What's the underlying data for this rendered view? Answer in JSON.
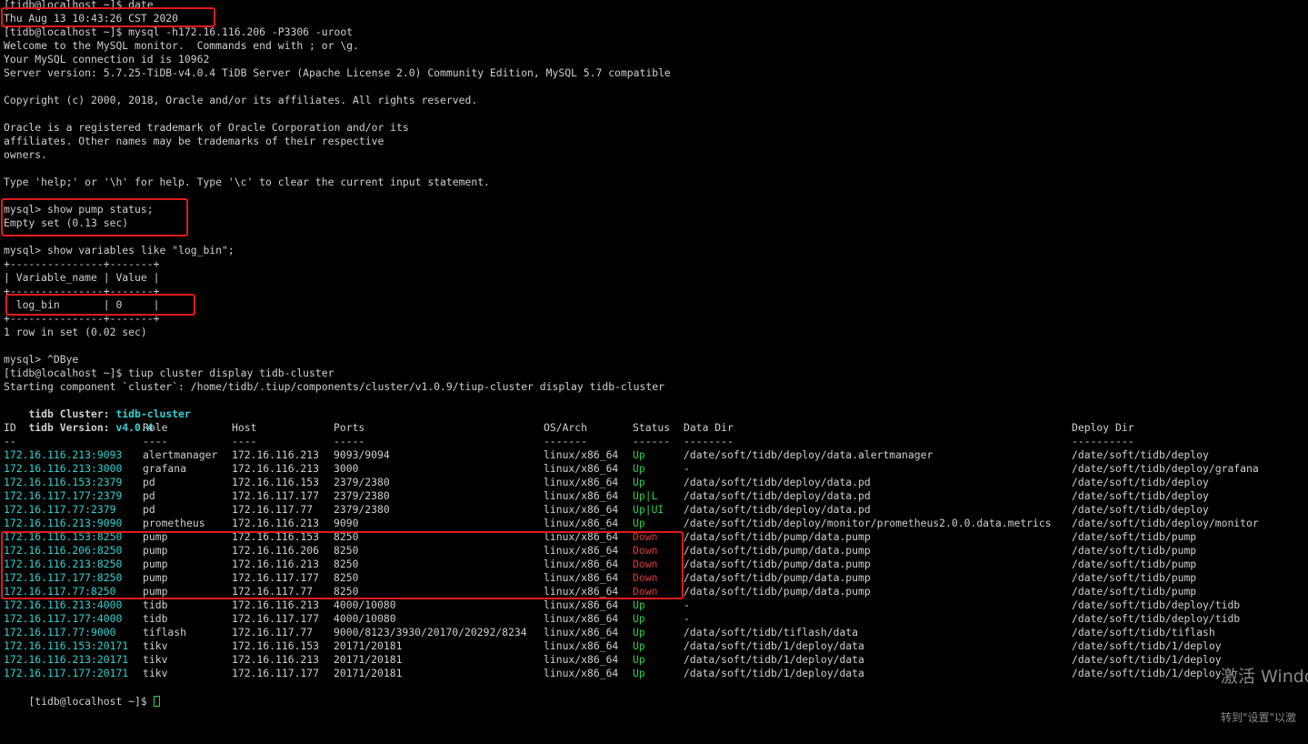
{
  "terminal": {
    "lines": [
      "[tidb@localhost ~]$ date",
      "Thu Aug 13 10:43:26 CST 2020",
      "[tidb@localhost ~]$ mysql -h172.16.116.206 -P3306 -uroot",
      "Welcome to the MySQL monitor.  Commands end with ; or \\g.",
      "Your MySQL connection id is 10962",
      "Server version: 5.7.25-TiDB-v4.0.4 TiDB Server (Apache License 2.0) Community Edition, MySQL 5.7 compatible",
      "",
      "Copyright (c) 2000, 2018, Oracle and/or its affiliates. All rights reserved.",
      "",
      "Oracle is a registered trademark of Oracle Corporation and/or its",
      "affiliates. Other names may be trademarks of their respective",
      "owners.",
      "",
      "Type 'help;' or '\\h' for help. Type '\\c' to clear the current input statement.",
      "",
      "mysql> show pump status;",
      "Empty set (0.13 sec)",
      "",
      "mysql> show variables like \"log_bin\";",
      "+---------------+-------+",
      "| Variable_name | Value |",
      "+---------------+-------+",
      "| log_bin       | 0     |",
      "+---------------+-------+",
      "1 row in set (0.02 sec)",
      "",
      "mysql> ^DBye",
      "[tidb@localhost ~]$ tiup cluster display tidb-cluster",
      "Starting component `cluster`: /home/tidb/.tiup/components/cluster/v1.0.9/tiup-cluster display tidb-cluster"
    ],
    "cluster_label": "tidb Cluster: ",
    "cluster_name": "tidb-cluster",
    "version_label": "tidb Version: ",
    "version_value": "v4.0.4",
    "table": {
      "headers": [
        "ID",
        "Role",
        "Host",
        "Ports",
        "OS/Arch",
        "Status",
        "Data Dir",
        "Deploy Dir"
      ],
      "separators": [
        "--",
        "----",
        "----",
        "-----",
        "-------",
        "------",
        "--------",
        "----------"
      ],
      "rows": [
        [
          "172.16.116.213:9093",
          "alertmanager",
          "172.16.116.213",
          "9093/9094",
          "linux/x86_64",
          "Up",
          "/date/soft/tidb/deploy/data.alertmanager",
          "/date/soft/tidb/deploy"
        ],
        [
          "172.16.116.213:3000",
          "grafana",
          "172.16.116.213",
          "3000",
          "linux/x86_64",
          "Up",
          "-",
          "/date/soft/tidb/deploy/grafana"
        ],
        [
          "172.16.116.153:2379",
          "pd",
          "172.16.116.153",
          "2379/2380",
          "linux/x86_64",
          "Up",
          "/data/soft/tidb/deploy/data.pd",
          "/date/soft/tidb/deploy"
        ],
        [
          "172.16.117.177:2379",
          "pd",
          "172.16.117.177",
          "2379/2380",
          "linux/x86_64",
          "Up|L",
          "/data/soft/tidb/deploy/data.pd",
          "/date/soft/tidb/deploy"
        ],
        [
          "172.16.117.77:2379",
          "pd",
          "172.16.117.77",
          "2379/2380",
          "linux/x86_64",
          "Up|UI",
          "/data/soft/tidb/deploy/data.pd",
          "/date/soft/tidb/deploy"
        ],
        [
          "172.16.116.213:9090",
          "prometheus",
          "172.16.116.213",
          "9090",
          "linux/x86_64",
          "Up",
          "/date/soft/tidb/deploy/monitor/prometheus2.0.0.data.metrics",
          "/date/soft/tidb/deploy/monitor"
        ],
        [
          "172.16.116.153:8250",
          "pump",
          "172.16.116.153",
          "8250",
          "linux/x86_64",
          "Down",
          "/data/soft/tidb/pump/data.pump",
          "/date/soft/tidb/pump"
        ],
        [
          "172.16.116.206:8250",
          "pump",
          "172.16.116.206",
          "8250",
          "linux/x86_64",
          "Down",
          "/data/soft/tidb/pump/data.pump",
          "/date/soft/tidb/pump"
        ],
        [
          "172.16.116.213:8250",
          "pump",
          "172.16.116.213",
          "8250",
          "linux/x86_64",
          "Down",
          "/data/soft/tidb/pump/data.pump",
          "/date/soft/tidb/pump"
        ],
        [
          "172.16.117.177:8250",
          "pump",
          "172.16.117.177",
          "8250",
          "linux/x86_64",
          "Down",
          "/data/soft/tidb/pump/data.pump",
          "/date/soft/tidb/pump"
        ],
        [
          "172.16.117.77:8250",
          "pump",
          "172.16.117.77",
          "8250",
          "linux/x86_64",
          "Down",
          "/data/soft/tidb/pump/data.pump",
          "/date/soft/tidb/pump"
        ],
        [
          "172.16.116.213:4000",
          "tidb",
          "172.16.116.213",
          "4000/10080",
          "linux/x86_64",
          "Up",
          "-",
          "/date/soft/tidb/deploy/tidb"
        ],
        [
          "172.16.117.177:4000",
          "tidb",
          "172.16.117.177",
          "4000/10080",
          "linux/x86_64",
          "Up",
          "-",
          "/date/soft/tidb/deploy/tidb"
        ],
        [
          "172.16.117.77:9000",
          "tiflash",
          "172.16.117.77",
          "9000/8123/3930/20170/20292/8234",
          "linux/x86_64",
          "Up",
          "/data/soft/tidb/tiflash/data",
          "/date/soft/tidb/tiflash"
        ],
        [
          "172.16.116.153:20171",
          "tikv",
          "172.16.116.153",
          "20171/20181",
          "linux/x86_64",
          "Up",
          "/data/soft/tidb/1/deploy/data",
          "/date/soft/tidb/1/deploy"
        ],
        [
          "172.16.116.213:20171",
          "tikv",
          "172.16.116.213",
          "20171/20181",
          "linux/x86_64",
          "Up",
          "/data/soft/tidb/1/deploy/data",
          "/date/soft/tidb/1/deploy"
        ],
        [
          "172.16.117.177:20171",
          "tikv",
          "172.16.117.177",
          "20171/20181",
          "linux/x86_64",
          "Up",
          "/data/soft/tidb/1/deploy/data",
          "/date/soft/tidb/1/deploy"
        ]
      ]
    },
    "final_prompt": "[tidb@localhost ~]$ ",
    "colors": {
      "background": "#000000",
      "text": "#cfcfcf",
      "id": "#2fd3d3",
      "up": "#2ad04a",
      "down": "#d83a3a",
      "highlight": "#e01b1b"
    }
  },
  "watermark": {
    "line1": "激活 Windo",
    "line2": "转到\"设置\"以激"
  }
}
